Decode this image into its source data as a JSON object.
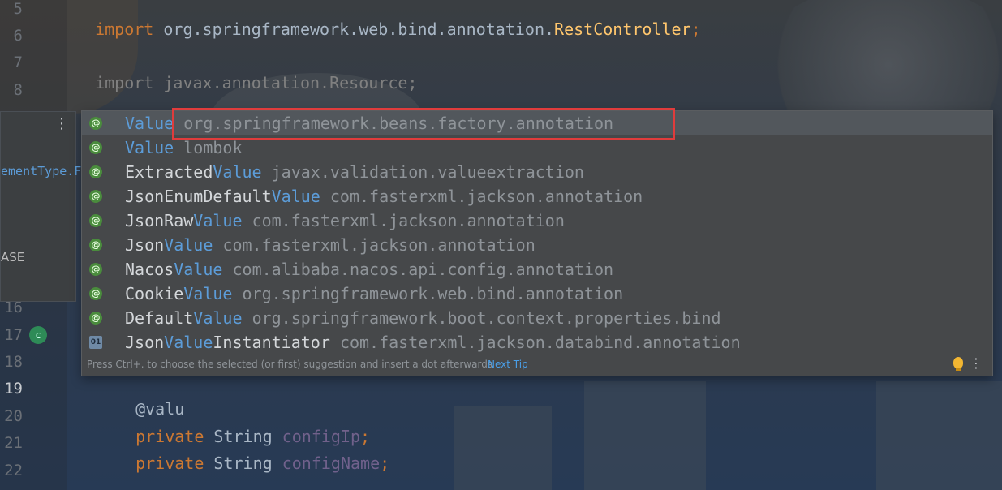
{
  "editor": {
    "line_numbers": [
      "5",
      "6",
      "7",
      "8",
      "16",
      "17",
      "18",
      "19",
      "20",
      "21",
      "22"
    ],
    "code": {
      "line5": {
        "kw": "import",
        "pkg": " org.springframework.web.bind.annotation.",
        "cls": "RestController",
        "end": ";"
      },
      "line7": {
        "kw": "import",
        "pkg": " javax.annotation.Resource;"
      },
      "line19": "@valu",
      "line20": {
        "kw": "private",
        "type": " String ",
        "field": "configIp",
        "end": ";"
      },
      "line21": {
        "kw": "private",
        "type": " String ",
        "field": "configName",
        "end": ";"
      }
    }
  },
  "side_panel": {
    "menu_icon": "more-vertical-icon",
    "text1": "ementType.F",
    "text2": "ASE"
  },
  "completion": {
    "items": [
      {
        "pre": "",
        "match": "Value",
        "suf": "",
        "pkg": "org.springframework.beans.factory.annotation",
        "icon": "annotation-icon"
      },
      {
        "pre": "",
        "match": "Value",
        "suf": "",
        "pkg": "lombok",
        "icon": "annotation-icon"
      },
      {
        "pre": "Extracted",
        "match": "Value",
        "suf": "",
        "pkg": "javax.validation.valueextraction",
        "icon": "annotation-icon"
      },
      {
        "pre": "JsonEnumDefault",
        "match": "Value",
        "suf": "",
        "pkg": "com.fasterxml.jackson.annotation",
        "icon": "annotation-icon"
      },
      {
        "pre": "JsonRaw",
        "match": "Value",
        "suf": "",
        "pkg": "com.fasterxml.jackson.annotation",
        "icon": "annotation-icon"
      },
      {
        "pre": "Json",
        "match": "Value",
        "suf": "",
        "pkg": "com.fasterxml.jackson.annotation",
        "icon": "annotation-icon"
      },
      {
        "pre": "Nacos",
        "match": "Value",
        "suf": "",
        "pkg": "com.alibaba.nacos.api.config.annotation",
        "icon": "annotation-icon"
      },
      {
        "pre": "Cookie",
        "match": "Value",
        "suf": "",
        "pkg": "org.springframework.web.bind.annotation",
        "icon": "annotation-icon"
      },
      {
        "pre": "Default",
        "match": "Value",
        "suf": "",
        "pkg": "org.springframework.boot.context.properties.bind",
        "icon": "annotation-icon"
      },
      {
        "pre": "Json",
        "match": "Value",
        "suf": "Instantiator",
        "pkg": "com.fasterxml.jackson.databind.annotation",
        "icon": "class-file-icon"
      }
    ],
    "footer_tip": "Press Ctrl+. to choose the selected (or first) suggestion and insert a dot afterwards",
    "next_tip": "Next Tip"
  },
  "colors": {
    "highlight_border": "#e03c3c",
    "match": "#5c9cd8",
    "keyword": "#cc7832",
    "class": "#ffc66d"
  }
}
